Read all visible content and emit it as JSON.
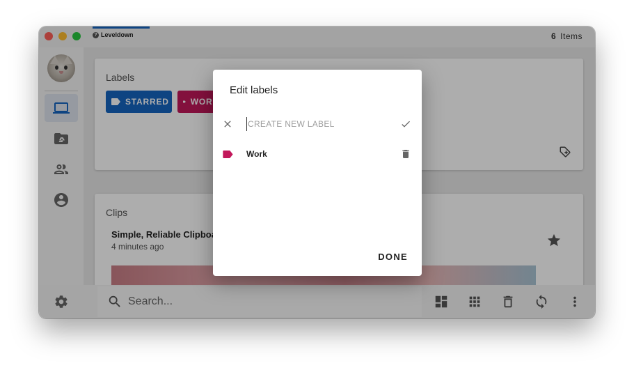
{
  "titlebar": {
    "app_name": "Leveldown",
    "items_count": "6",
    "items_label": "Items"
  },
  "sidebar": {
    "items": [
      {
        "name": "laptop-icon",
        "active": true
      },
      {
        "name": "drive-folder-icon",
        "active": false
      },
      {
        "name": "people-icon",
        "active": false
      },
      {
        "name": "account-circle-icon",
        "active": false
      }
    ],
    "settings_icon": "gear-icon"
  },
  "labels_card": {
    "title": "Labels",
    "chips": [
      {
        "label": "STARRED",
        "color": "#1565c0"
      },
      {
        "label": "WORK",
        "color": "#c2185b"
      }
    ]
  },
  "clips_card": {
    "title": "Clips",
    "clip": {
      "title": "Simple, Reliable Clipboard",
      "time": "4 minutes ago"
    }
  },
  "bottombar": {
    "search_placeholder": "Search...",
    "icons": [
      "dashboard-icon",
      "apps-grid-icon",
      "trash-icon",
      "sync-icon",
      "more-vert-icon"
    ]
  },
  "dialog": {
    "title": "Edit labels",
    "new_label_placeholder": "CREATE NEW LABEL",
    "labels": [
      {
        "name": "Work",
        "color": "#c2185b"
      }
    ],
    "done_label": "DONE"
  },
  "colors": {
    "accent_blue": "#1565c0",
    "work_pink": "#c2185b"
  }
}
